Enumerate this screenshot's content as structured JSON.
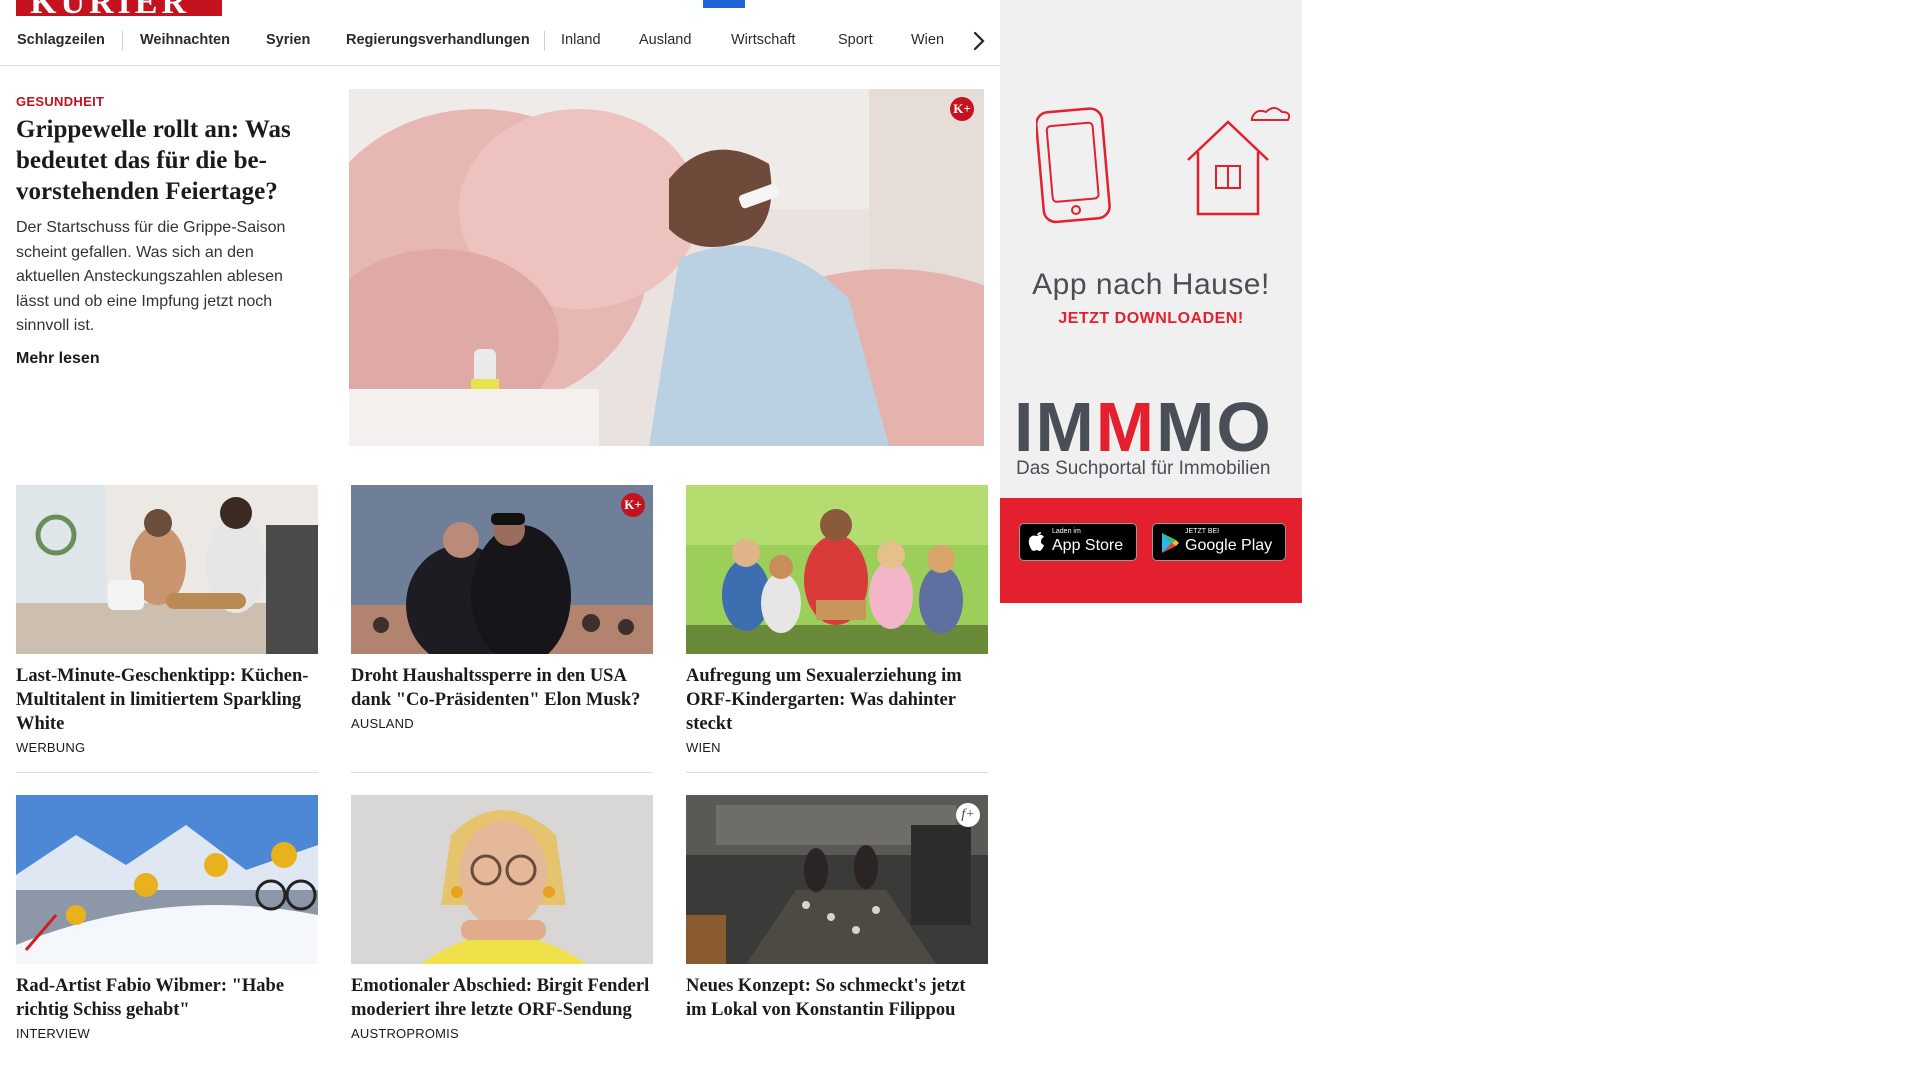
{
  "header": {
    "logo_text": "KURIER"
  },
  "nav": {
    "items": [
      {
        "label": "Schlagzeilen"
      },
      {
        "label": "Weihnachten"
      },
      {
        "label": "Syrien"
      },
      {
        "label": "Regierungsverhandlungen"
      },
      {
        "label": "Inland"
      },
      {
        "label": "Ausland"
      },
      {
        "label": "Wirtschaft"
      },
      {
        "label": "Sport"
      },
      {
        "label": "Wien"
      }
    ],
    "next_icon": "chevron-right-icon"
  },
  "hero": {
    "category": "GESUNDHEIT",
    "title": "Grippewelle rollt an: Was bedeutet das für die be­vorstehenden Feiertage?",
    "teaser": "Der Startschuss für die Grippe-Saison scheint gefallen. Was sich an den aktuellen Ansteckungszahlen ablesen lässt und ob eine Impfung jetzt noch sinnvoll ist.",
    "more_label": "Mehr lesen",
    "badge": "K+"
  },
  "cards": [
    {
      "title": "Last-Minute-Geschenktipp: Kü­chen-Multitalent in limitiertem Sparkling White",
      "category": "WERBUNG"
    },
    {
      "title": "Droht Haushaltssperre in den USA dank \"Co-Präsidenten\" Elon Musk?",
      "category": "AUSLAND",
      "badge": "K+"
    },
    {
      "title": "Aufregung um Sexualerziehung im ORF-Kindergarten: Was dahinter steckt",
      "category": "WIEN"
    },
    {
      "title": "Rad-Artist Fabio Wibmer: \"Habe richtig Schiss gehabt\"",
      "category": "INTERVIEW"
    },
    {
      "title": "Emotionaler Abschied: Birgit Fen­derl moderiert ihre letzte ORF-Sendung",
      "category": "AUSTROPROMIS"
    },
    {
      "title": "Neues Konzept: So schmeckt's jetzt im Lokal von Konstantin Filippou",
      "category": "",
      "badge": "f+"
    }
  ],
  "ad": {
    "headline": "App nach Hause!",
    "cta": "JETZT DOWNLOADEN!",
    "brand_pre": "IM",
    "brand_mid": "M",
    "brand_post": "MO",
    "tagline": "Das Suchportal für Immobilien",
    "appstore_small": "Laden im",
    "appstore_big": "App Store",
    "googleplay_small": "JETZT BEI",
    "googleplay_big": "Google Play"
  }
}
